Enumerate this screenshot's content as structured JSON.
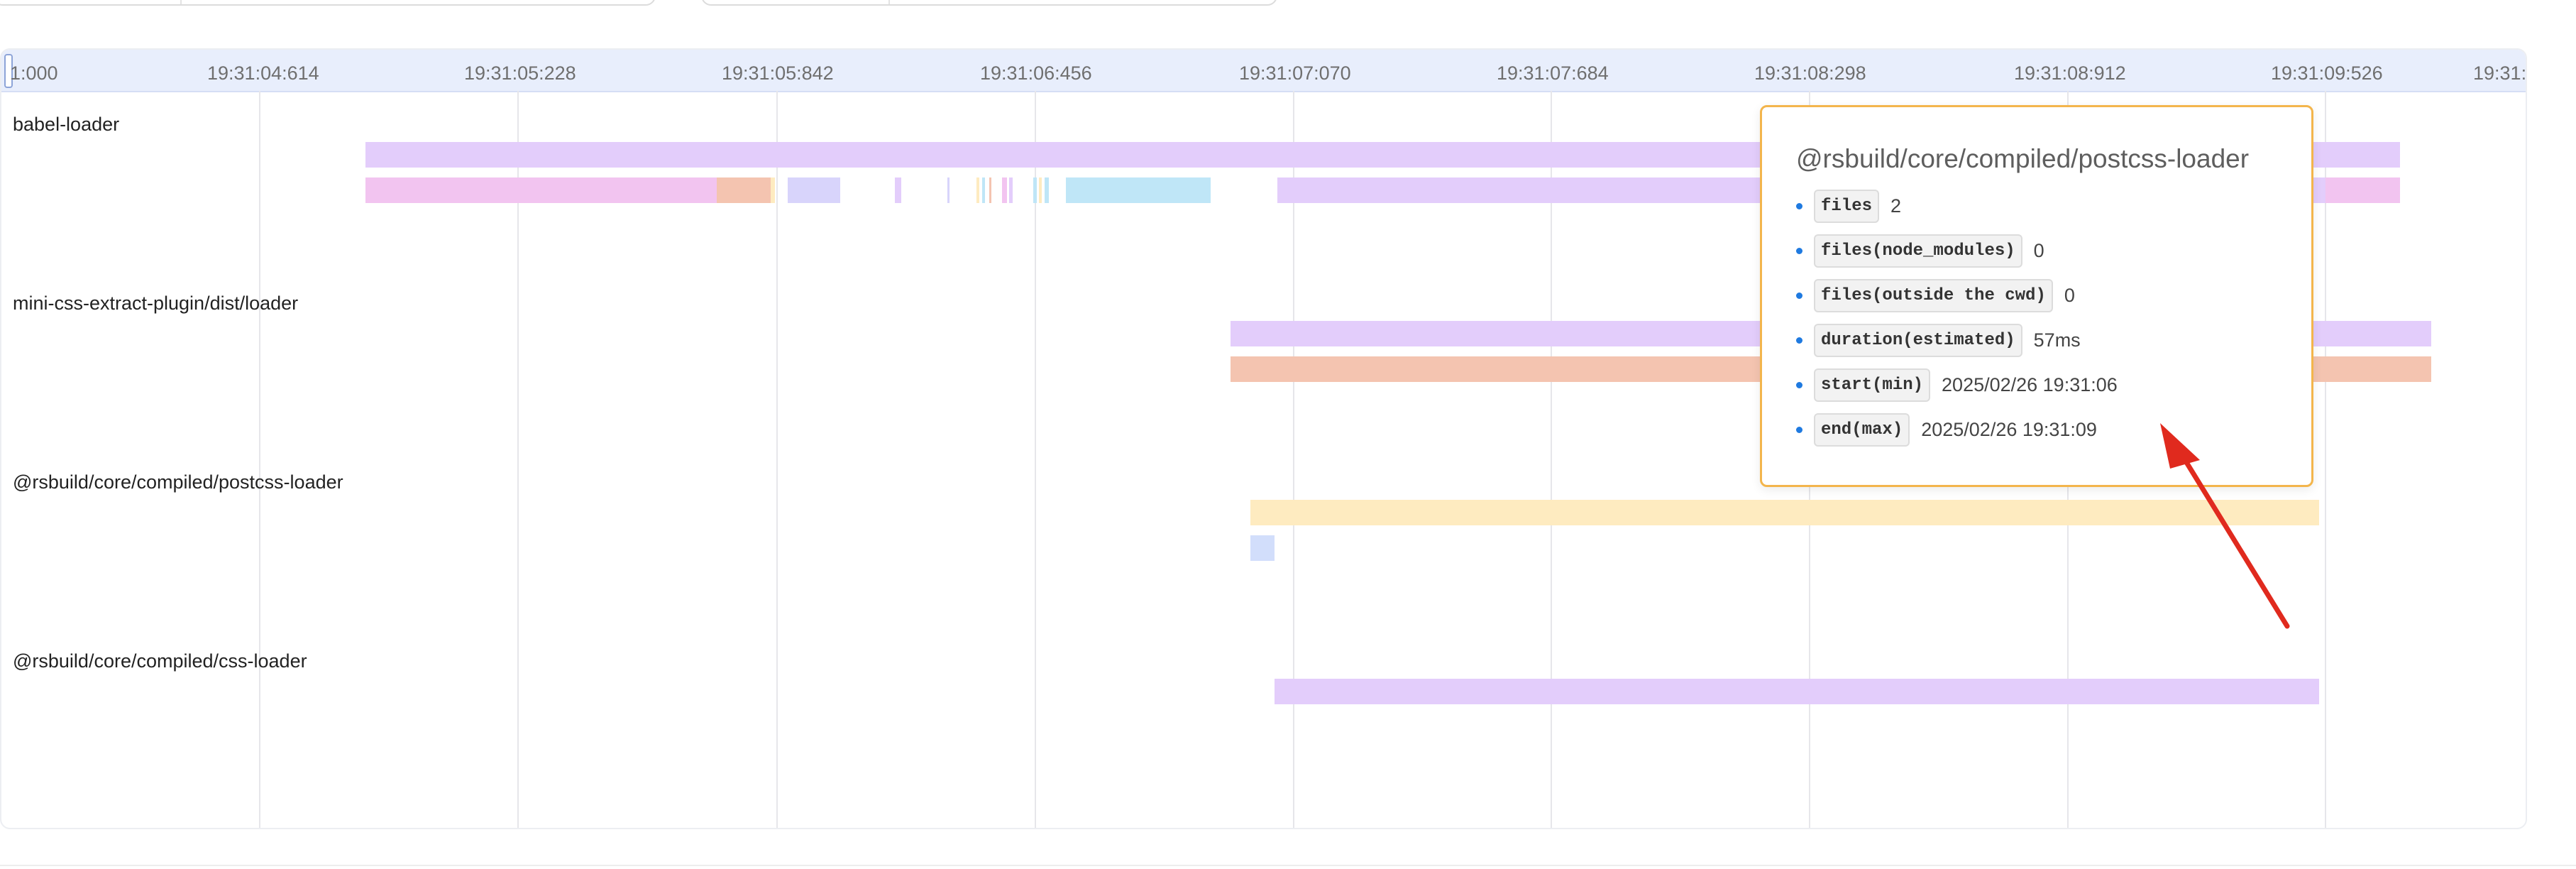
{
  "timeline": {
    "ticks": [
      "1:000",
      "19:31:04:614",
      "19:31:05:228",
      "19:31:05:842",
      "19:31:06:456",
      "19:31:07:070",
      "19:31:07:684",
      "19:31:08:298",
      "19:31:08:912",
      "19:31:09:526",
      "19:31:"
    ],
    "rows": [
      {
        "label": "babel-loader"
      },
      {
        "label": "mini-css-extract-plugin/dist/loader"
      },
      {
        "label": "@rsbuild/core/compiled/postcss-loader"
      },
      {
        "label": "@rsbuild/core/compiled/css-loader"
      }
    ],
    "colors": {
      "purple": "#e3cdfb",
      "pink": "#f2c4f0",
      "salmon": "#f4c4b0",
      "lavender": "#d8d4fb",
      "sky": "#bfe6f7",
      "yellow": "#feebc0",
      "blue": "#d2defb"
    }
  },
  "tooltip": {
    "title": "@rsbuild/core/compiled/postcss-loader",
    "items": [
      {
        "key": "files",
        "value": "2"
      },
      {
        "key": "files(node_modules)",
        "value": "0"
      },
      {
        "key": "files(outside the cwd)",
        "value": "0"
      },
      {
        "key": "duration(estimated)",
        "value": "57ms"
      },
      {
        "key": "start(min)",
        "value": "2025/02/26 19:31:06"
      },
      {
        "key": "end(max)",
        "value": "2025/02/26 19:31:09"
      }
    ]
  },
  "annotation": {
    "arrow_color": "#e02a1e"
  }
}
